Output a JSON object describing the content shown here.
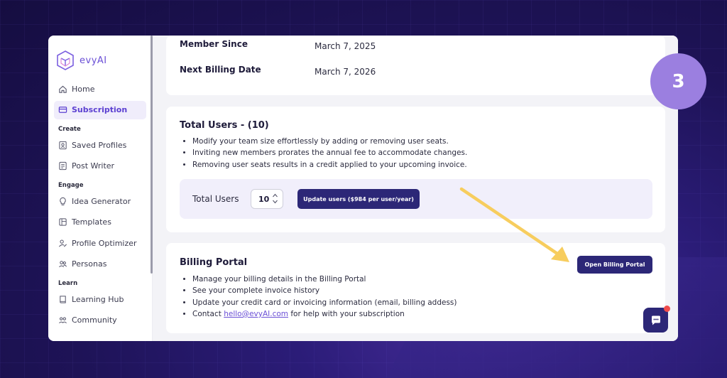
{
  "brand": {
    "name": "evyAI"
  },
  "sidebar": {
    "items_top": [
      {
        "label": "Home",
        "icon": "home-icon"
      },
      {
        "label": "Subscription",
        "icon": "credit-card-icon",
        "active": true
      }
    ],
    "sections": [
      {
        "label": "Create",
        "items": [
          {
            "label": "Saved Profiles",
            "icon": "profile-card-icon"
          },
          {
            "label": "Post Writer",
            "icon": "document-icon"
          }
        ]
      },
      {
        "label": "Engage",
        "items": [
          {
            "label": "Idea Generator",
            "icon": "lightbulb-icon"
          },
          {
            "label": "Templates",
            "icon": "template-icon"
          },
          {
            "label": "Profile Optimizer",
            "icon": "user-edit-icon"
          },
          {
            "label": "Personas",
            "icon": "users-icon"
          }
        ]
      },
      {
        "label": "Learn",
        "items": [
          {
            "label": "Learning Hub",
            "icon": "book-icon"
          },
          {
            "label": "Community",
            "icon": "community-icon"
          }
        ]
      }
    ]
  },
  "membership": {
    "member_since_label": "Member Since",
    "member_since_value": "March 7, 2025",
    "next_billing_label": "Next Billing Date",
    "next_billing_value": "March 7, 2026"
  },
  "total_users": {
    "title": "Total Users - (10)",
    "bullets": [
      "Modify your team size effortlessly by adding or removing user seats.",
      "Inviting new members prorates the annual fee to accommodate changes.",
      "Removing user seats results in a credit applied to your upcoming invoice."
    ],
    "field_label": "Total Users",
    "value": "10",
    "update_button": "Update users ($984 per user/year)"
  },
  "billing_portal": {
    "title": "Billing Portal",
    "bullets": [
      "Manage your billing details in the Billing Portal",
      "See your complete invoice history",
      "Update your credit card or invoicing information (email, billing addess)"
    ],
    "contact_prefix": "Contact ",
    "contact_email": "hello@evyAI.com",
    "contact_suffix": " for help with your subscription",
    "open_button": "Open Billing Portal"
  },
  "step_badge": "3",
  "colors": {
    "accent": "#6a4fd6",
    "button_dark": "#2c2777",
    "badge": "#9b7fe0",
    "arrow": "#f7cd5e",
    "background": "#1e1357"
  }
}
